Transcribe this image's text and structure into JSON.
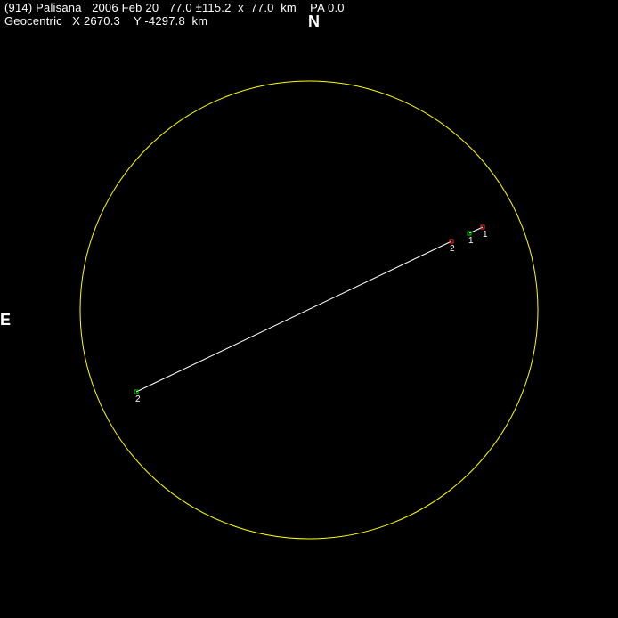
{
  "header": {
    "line1": "(914) Palisana   2006 Feb 20   77.0 ±115.2  x  77.0  km    PA 0.0",
    "line2": "Geocentric   X 2670.3    Y -4297.8  km"
  },
  "compass": {
    "north": "N",
    "east": "E"
  },
  "colors": {
    "background": "#000000",
    "ellipse": "#ffff00",
    "chord": "#ffffff",
    "disappear": "#ff3030",
    "reappear": "#00cc00",
    "text": "#ffffff"
  },
  "chords": [
    {
      "id": "1",
      "disappear_label": "1",
      "reappear_label": "1"
    },
    {
      "id": "2",
      "disappear_label": "2",
      "reappear_label": "2"
    }
  ]
}
